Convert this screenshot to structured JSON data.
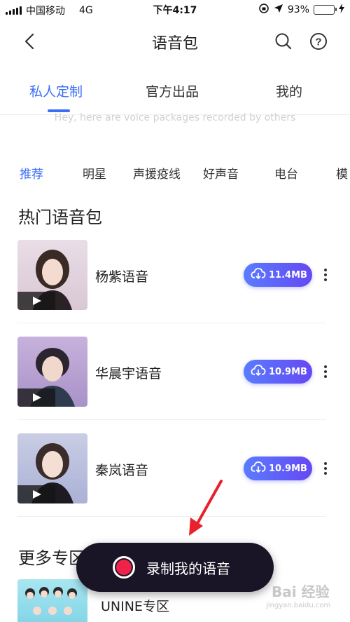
{
  "status_bar": {
    "carrier": "中国移动",
    "network": "4G",
    "time": "下午4:17",
    "battery": "93%",
    "battery_level": 0.93
  },
  "nav": {
    "title": "语音包",
    "back_icon": "chevron-left-icon",
    "search_icon": "search-icon",
    "help_icon": "help-circle-icon"
  },
  "tabs": [
    {
      "label": "私人定制",
      "active": true
    },
    {
      "label": "官方出品",
      "active": false
    },
    {
      "label": "我的",
      "active": false
    }
  ],
  "subtitle": "Hey, here are voice packages recorded by others",
  "categories": [
    {
      "label": "推荐",
      "active": true
    },
    {
      "label": "明星",
      "active": false
    },
    {
      "label": "声援疫线",
      "active": false
    },
    {
      "label": "好声音",
      "active": false
    },
    {
      "label": "电台",
      "active": false
    },
    {
      "label": "模",
      "active": false
    }
  ],
  "hot_section": {
    "title": "热门语音包",
    "items": [
      {
        "name": "杨紫语音",
        "size": "11.4MB"
      },
      {
        "name": "华晨宇语音",
        "size": "10.9MB"
      },
      {
        "name": "秦岚语音",
        "size": "10.9MB"
      }
    ]
  },
  "more_section": {
    "title": "更多专区",
    "items": [
      {
        "name": "UNINE专区"
      }
    ]
  },
  "record_button": {
    "label": "录制我的语音"
  },
  "watermark": {
    "text": "Bai 经验",
    "sub": "jingyan.baidu.com"
  },
  "colors": {
    "accent": "#3b6df5",
    "download_gradient_start": "#5a7cff",
    "download_gradient_end": "#6548f2",
    "record_dot": "#f1224a",
    "annotation_arrow": "#e8212c"
  }
}
